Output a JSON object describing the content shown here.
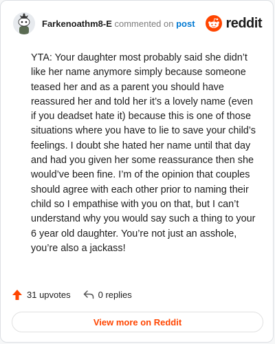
{
  "header": {
    "username": "Farkenoathm8-E",
    "commented_on": " commented on ",
    "post_link": "post",
    "logo_text": "reddit"
  },
  "comment": {
    "text": "YTA: Your daughter most probably said she didn’t like her name anymore simply because someone teased her and as a parent you should have reassured her and told her it’s a lovely name (even if you deadset hate it) because this is one of those situations where you have to lie to save your child’s feelings. I doubt she hated her name until that day and had you given her some reassurance then she would’ve been fine. I’m of the opinion that couples should agree with each other prior to naming their child so I empathise with you on that, but I can’t understand why you would say such a thing to your 6 year old daughter. You’re not just an asshole, you’re also a jackass!"
  },
  "actions": {
    "upvotes": "31 upvotes",
    "replies": "0 replies"
  },
  "footer": {
    "view_more": "View more on Reddit"
  },
  "colors": {
    "brand": "#ff4500",
    "link": "#0079d3",
    "text": "#1c1c1c"
  },
  "icons": {
    "avatar": "snoo-avatar",
    "logo": "reddit-alien-icon",
    "upvote": "upvote-arrow-icon",
    "reply": "reply-arrow-icon"
  }
}
